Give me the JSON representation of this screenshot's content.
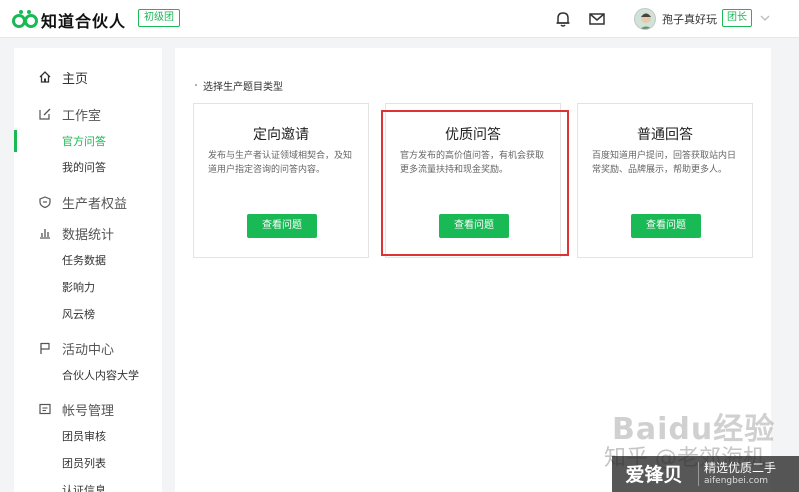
{
  "header": {
    "brand": "知道合伙人",
    "level_tag": "初级团",
    "username": "孢子真好玩",
    "role_tag": "团长",
    "icons": [
      "bell-icon",
      "mail-icon",
      "chevron-down-icon"
    ]
  },
  "sidebar": {
    "home": "主页",
    "studio": "工作室",
    "studio_items": [
      "官方问答",
      "我的问答"
    ],
    "rights": "生产者权益",
    "stats": "数据统计",
    "stats_items": [
      "任务数据",
      "影响力",
      "风云榜"
    ],
    "events": "活动中心",
    "events_items": [
      "合伙人内容大学"
    ],
    "account": "帐号管理",
    "account_items": [
      "团员审核",
      "团员列表",
      "认证信息"
    ]
  },
  "main": {
    "section_title": "选择生产题目类型",
    "cards": [
      {
        "title": "定向邀请",
        "desc": "发布与生产者认证领域相契合，及知道用户指定咨询的问答内容。",
        "button": "查看问题"
      },
      {
        "title": "优质问答",
        "desc": "官方发布的高价值问答，有机会获取更多流量扶持和现金奖励。",
        "button": "查看问题"
      },
      {
        "title": "普通回答",
        "desc": "百度知道用户提问，回答获取站内日常奖励、品牌展示，帮助更多人。",
        "button": "查看问题"
      }
    ]
  },
  "watermark": {
    "baidu": "Baidu经验",
    "zhihu": "知乎 @老郊海机",
    "badge_big": "爱锋贝",
    "badge_line1": "精选优质二手",
    "badge_line2": "aifengbei.com"
  },
  "colors": {
    "accent": "#19b955",
    "highlight": "#dd3333"
  }
}
